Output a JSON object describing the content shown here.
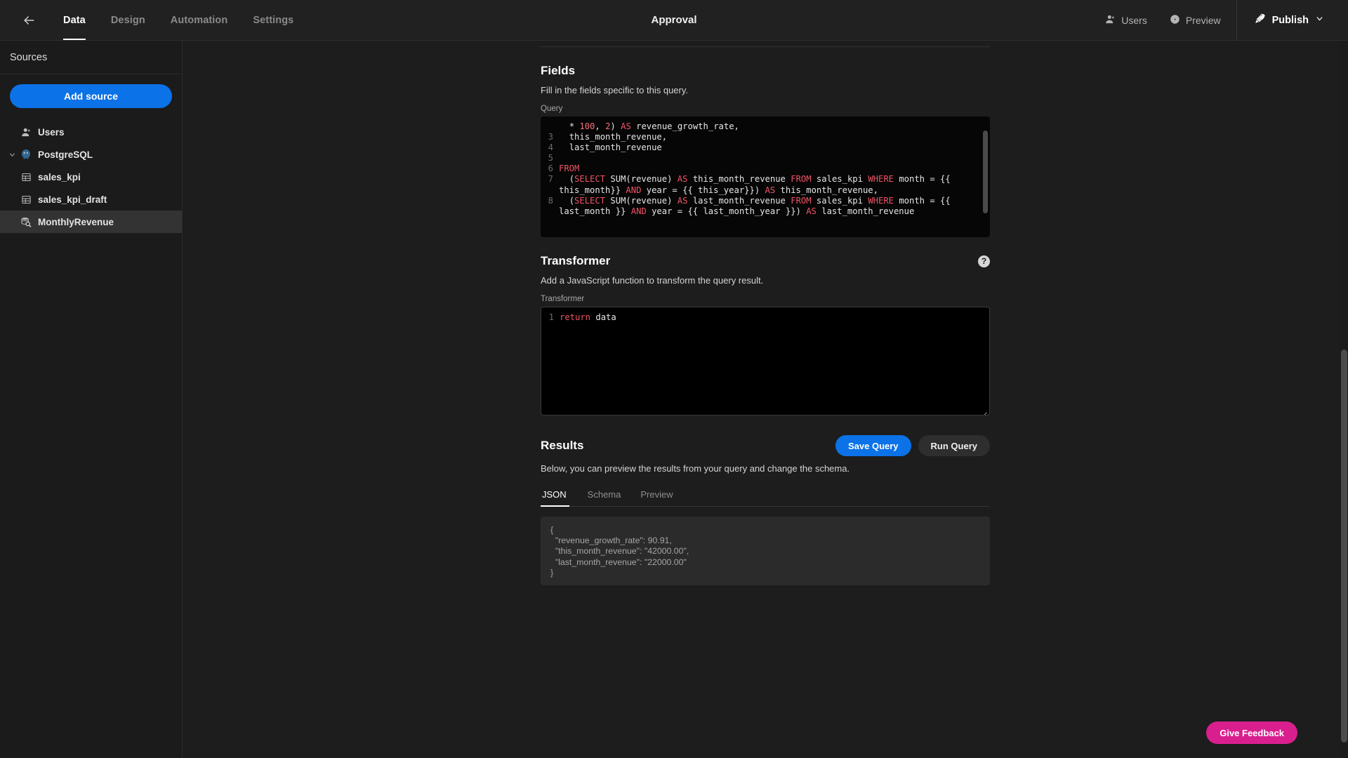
{
  "header": {
    "back_icon": "arrow-left-icon",
    "tabs": [
      {
        "label": "Data",
        "active": true
      },
      {
        "label": "Design",
        "active": false
      },
      {
        "label": "Automation",
        "active": false
      },
      {
        "label": "Settings",
        "active": false
      }
    ],
    "title": "Approval",
    "users_label": "Users",
    "preview_label": "Preview",
    "publish_label": "Publish"
  },
  "sidebar": {
    "heading": "Sources",
    "add_source_label": "Add source",
    "items": [
      {
        "label": "Users",
        "icon": "user-icon",
        "level": 0,
        "selected": false,
        "twisty": ""
      },
      {
        "label": "PostgreSQL",
        "icon": "postgresql-icon",
        "level": 0,
        "selected": false,
        "twisty": "chevron-down-icon"
      },
      {
        "label": "sales_kpi",
        "icon": "table-icon",
        "level": 2,
        "selected": false,
        "twisty": ""
      },
      {
        "label": "sales_kpi_draft",
        "icon": "table-icon",
        "level": 2,
        "selected": false,
        "twisty": ""
      },
      {
        "label": "MonthlyRevenue",
        "icon": "query-icon",
        "level": 2,
        "selected": true,
        "twisty": ""
      }
    ]
  },
  "fields": {
    "title": "Fields",
    "subtitle": "Fill in the fields specific to this query.",
    "query_label": "Query",
    "code_lines": [
      {
        "num": "",
        "tokens": [
          {
            "t": "  * ",
            "c": "plain"
          },
          {
            "t": "100",
            "c": "num"
          },
          {
            "t": ", ",
            "c": "plain"
          },
          {
            "t": "2",
            "c": "num"
          },
          {
            "t": ") ",
            "c": "plain"
          },
          {
            "t": "AS",
            "c": "kw"
          },
          {
            "t": " revenue_growth_rate,",
            "c": "plain"
          }
        ]
      },
      {
        "num": "3",
        "tokens": [
          {
            "t": "  this_month_revenue,",
            "c": "plain"
          }
        ]
      },
      {
        "num": "4",
        "tokens": [
          {
            "t": "  last_month_revenue",
            "c": "plain"
          }
        ]
      },
      {
        "num": "5",
        "tokens": [
          {
            "t": "",
            "c": "plain"
          }
        ]
      },
      {
        "num": "6",
        "tokens": [
          {
            "t": "FROM",
            "c": "kw"
          }
        ]
      },
      {
        "num": "7",
        "tokens": [
          {
            "t": "  (",
            "c": "plain"
          },
          {
            "t": "SELECT",
            "c": "kw"
          },
          {
            "t": " SUM(revenue) ",
            "c": "plain"
          },
          {
            "t": "AS",
            "c": "kw"
          },
          {
            "t": " this_month_revenue ",
            "c": "plain"
          },
          {
            "t": "FROM",
            "c": "kw"
          },
          {
            "t": " sales_kpi ",
            "c": "plain"
          },
          {
            "t": "WHERE",
            "c": "kw"
          },
          {
            "t": " month = {{ this_month}} ",
            "c": "plain"
          },
          {
            "t": "AND",
            "c": "kw"
          },
          {
            "t": " year = {{ this_year}}) ",
            "c": "plain"
          },
          {
            "t": "AS",
            "c": "kw"
          },
          {
            "t": " this_month_revenue,",
            "c": "plain"
          }
        ]
      },
      {
        "num": "8",
        "tokens": [
          {
            "t": "  (",
            "c": "plain"
          },
          {
            "t": "SELECT",
            "c": "kw"
          },
          {
            "t": " SUM(revenue) ",
            "c": "plain"
          },
          {
            "t": "AS",
            "c": "kw"
          },
          {
            "t": " last_month_revenue ",
            "c": "plain"
          },
          {
            "t": "FROM",
            "c": "kw"
          },
          {
            "t": " sales_kpi ",
            "c": "plain"
          },
          {
            "t": "WHERE",
            "c": "kw"
          },
          {
            "t": " month = {{ last_month }} ",
            "c": "plain"
          },
          {
            "t": "AND",
            "c": "kw"
          },
          {
            "t": " year = {{ last_month_year }}) ",
            "c": "plain"
          },
          {
            "t": "AS",
            "c": "kw"
          },
          {
            "t": " last_month_revenue",
            "c": "plain"
          }
        ]
      }
    ]
  },
  "transformer": {
    "title": "Transformer",
    "subtitle": "Add a JavaScript function to transform the query result.",
    "field_label": "Transformer",
    "help_icon": "help-icon",
    "help_glyph": "?",
    "code_lines": [
      {
        "num": "1",
        "tokens": [
          {
            "t": "return",
            "c": "kw"
          },
          {
            "t": " data",
            "c": "plain"
          }
        ]
      }
    ]
  },
  "results": {
    "title": "Results",
    "save_label": "Save Query",
    "run_label": "Run Query",
    "subtitle": "Below, you can preview the results from your query and change the schema.",
    "tabs": [
      {
        "label": "JSON",
        "active": true
      },
      {
        "label": "Schema",
        "active": false
      },
      {
        "label": "Preview",
        "active": false
      }
    ],
    "json_output": "{\n  \"revenue_growth_rate\": 90.91,\n  \"this_month_revenue\": \"42000.00\",\n  \"last_month_revenue\": \"22000.00\"\n}"
  },
  "feedback": {
    "label": "Give Feedback"
  },
  "colors": {
    "accent_blue": "#0b72e7",
    "feedback_pink": "#d91f8e",
    "keyword_red": "#ef5366",
    "number_pink": "#f07178",
    "sidebar_bg": "#1b1b1b",
    "page_bg": "#1d1d1d"
  }
}
